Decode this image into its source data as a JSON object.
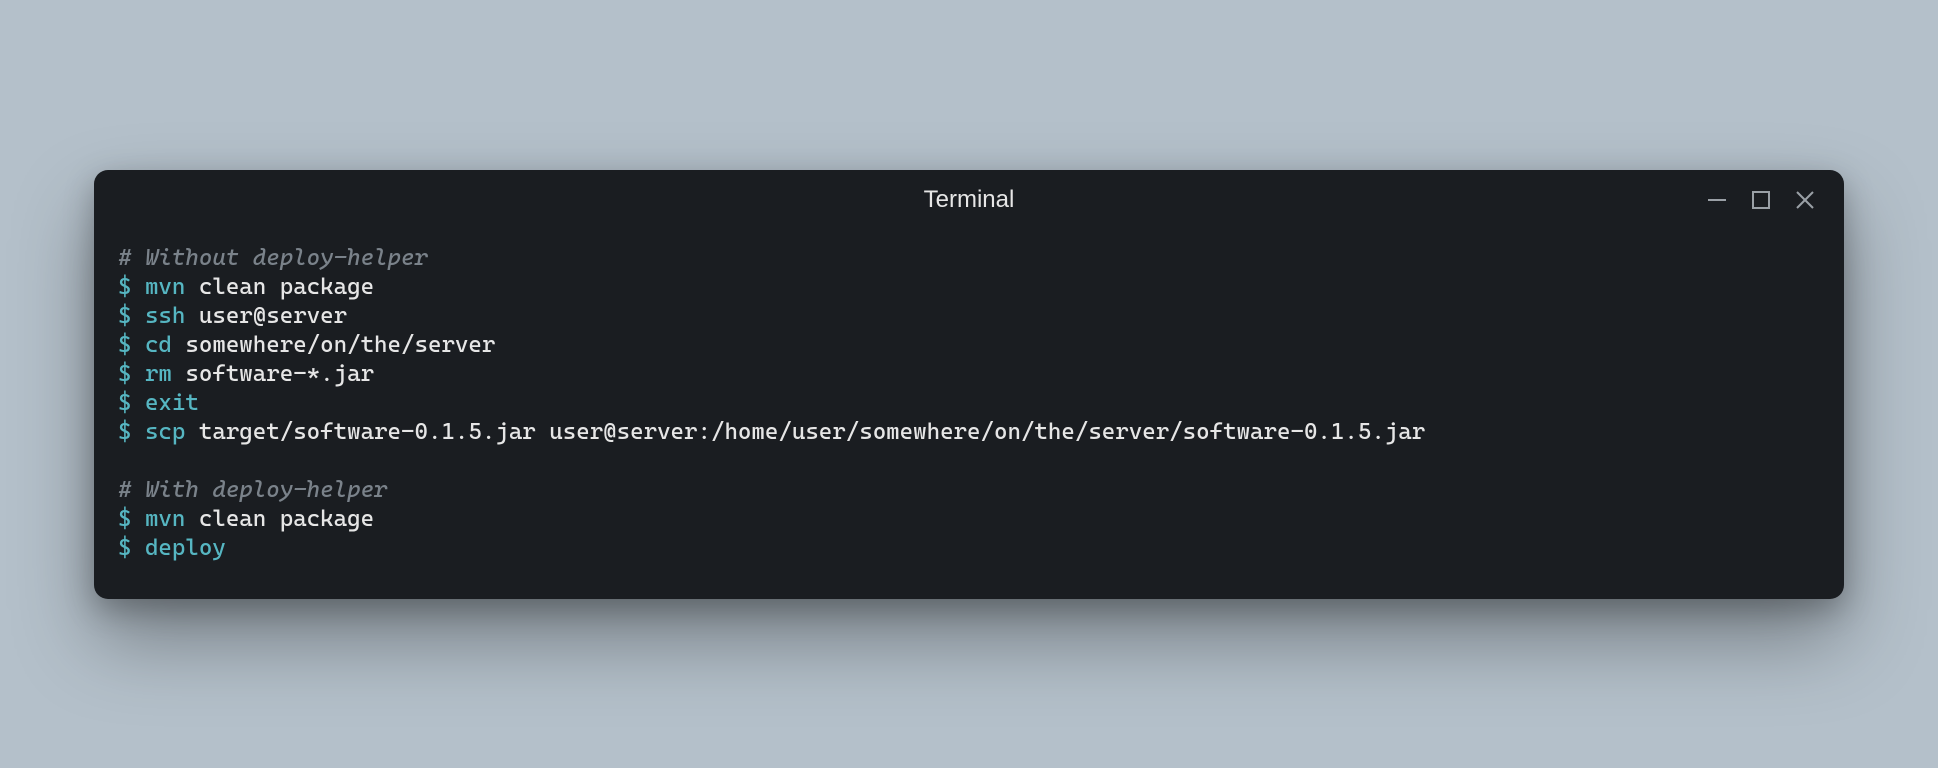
{
  "window": {
    "title": "Terminal"
  },
  "colors": {
    "background": "#1a1d21",
    "page_bg": "#b4c0ca",
    "prompt": "#56b6c2",
    "command": "#56b6c2",
    "text": "#e6e6e6",
    "comment": "#7a828a"
  },
  "content": {
    "comment1": "# Without deploy-helper",
    "lines1": [
      {
        "prompt": "$ ",
        "cmd": "mvn",
        "args": " clean package"
      },
      {
        "prompt": "$ ",
        "cmd": "ssh",
        "args": " user@server"
      },
      {
        "prompt": "$ ",
        "cmd": "cd",
        "args": " somewhere/on/the/server"
      },
      {
        "prompt": "$ ",
        "cmd": "rm",
        "args": " software-*.jar"
      },
      {
        "prompt": "$ ",
        "cmd": "exit",
        "args": ""
      },
      {
        "prompt": "$ ",
        "cmd": "scp",
        "args": " target/software-0.1.5.jar user@server:/home/user/somewhere/on/the/server/software-0.1.5.jar"
      }
    ],
    "comment2": "# With deploy-helper",
    "lines2": [
      {
        "prompt": "$ ",
        "cmd": "mvn",
        "args": " clean package"
      },
      {
        "prompt": "$ ",
        "cmd": "deploy",
        "args": ""
      }
    ]
  }
}
